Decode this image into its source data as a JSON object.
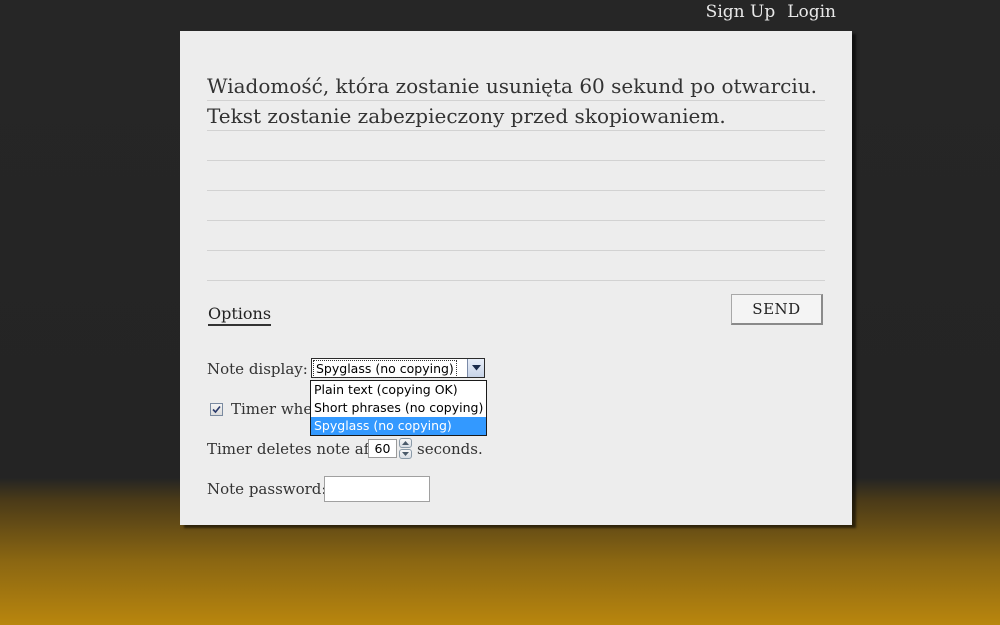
{
  "nav": {
    "signup_label": "Sign Up",
    "login_label": "Login"
  },
  "note": {
    "message": "Wiadomość, która zostanie usunięta 60 sekund po otwarciu. Tekst zostanie zabezpieczony przed skopiowaniem."
  },
  "actions": {
    "options_label": "Options",
    "send_label": "SEND"
  },
  "options": {
    "note_display_label": "Note display:",
    "note_display_value": "Spyglass (no copying)",
    "note_display_options": [
      "Plain text (copying OK)",
      "Short phrases (no copying)",
      "Spyglass (no copying)"
    ],
    "timer_checkbox_label": "Timer when",
    "timer_checked": true,
    "timer_prefix": "Timer deletes note after",
    "timer_seconds": "60",
    "timer_suffix": "seconds.",
    "password_label": "Note password:",
    "password_value": ""
  },
  "icons": {
    "dropdown_arrow": "chevron-down-icon",
    "checkbox_mark": "check-icon",
    "stepper_up": "chevron-up-icon",
    "stepper_down": "chevron-down-icon"
  }
}
